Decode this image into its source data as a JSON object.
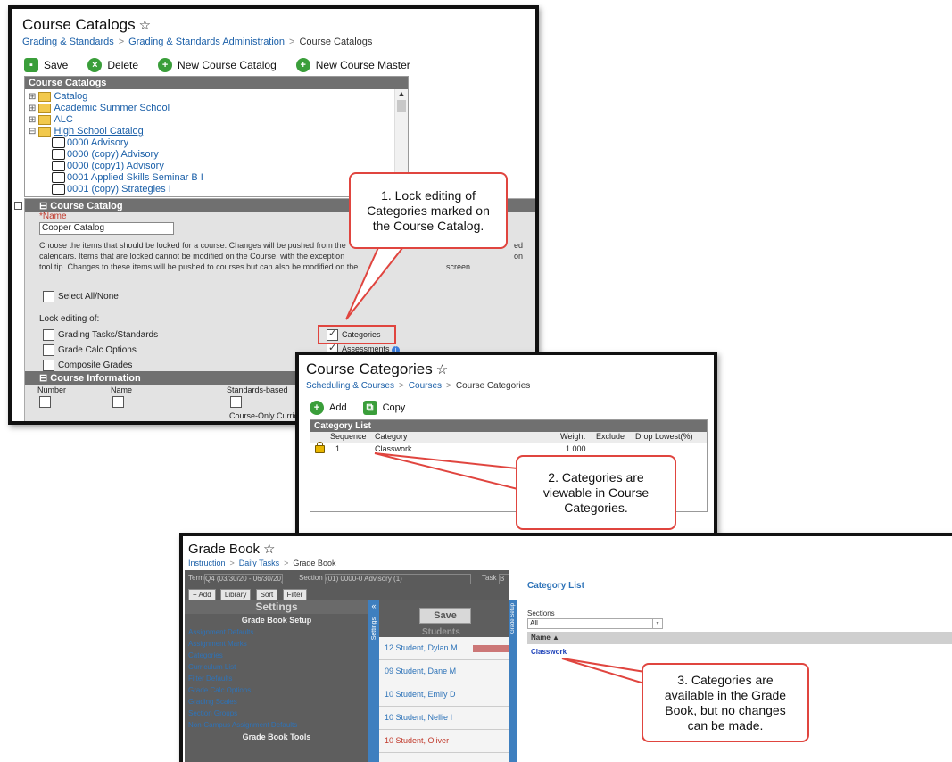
{
  "colors": {
    "accent": "#3a9e3a",
    "link": "#1a5fa8",
    "callout_border": "#e0453f",
    "header": "#707070"
  },
  "panel1": {
    "title": "Course Catalogs",
    "breadcrumb": [
      "Grading & Standards",
      "Grading & Standards Administration",
      "Course Catalogs"
    ],
    "toolbar": {
      "save": "Save",
      "delete": "Delete",
      "new_catalog": "New Course Catalog",
      "new_master": "New Course Master"
    },
    "tree_header": "Course Catalogs",
    "tree": [
      "Catalog",
      "Academic Summer School",
      "ALC",
      "High School Catalog",
      "0000 Advisory",
      "0000 (copy) Advisory",
      "0000 (copy1) Advisory",
      "0001 Applied Skills Seminar B I",
      "0001 (copy) Strategies I"
    ],
    "section_header": "Course Catalog",
    "name_label": "*Name",
    "name_value": "Cooper Catalog",
    "description_1": "Choose the items that should be locked for a course. Changes will be pushed from the",
    "description_1_end": "ed",
    "description_2": "calendars. Items that are locked cannot be modified on the Course, with the exception",
    "description_2_end": "on",
    "description_3": "tool tip. Changes to these items will be pushed to courses but can also be modified on the",
    "description_3_end": "screen.",
    "select_all": "Select All/None",
    "lock_label": "Lock editing of:",
    "options_left": [
      "Grading Tasks/Standards",
      "Grade Calc Options",
      "Composite Grades"
    ],
    "option_categories": "Categories",
    "option_assessments": "Assessments",
    "info_header": "Course Information",
    "info_cols": {
      "number": "Number",
      "name": "Name",
      "standards": "Standards-based",
      "curriculum": "Course-Only Curricu"
    }
  },
  "panel2": {
    "title": "Course Categories",
    "breadcrumb": [
      "Scheduling & Courses",
      "Courses",
      "Course Categories"
    ],
    "toolbar": {
      "add": "Add",
      "copy": "Copy"
    },
    "list_header": "Category List",
    "columns": [
      "Sequence",
      "Category",
      "Weight",
      "Exclude",
      "Drop Lowest(%)"
    ],
    "rows": [
      {
        "sequence": "1",
        "category": "Classwork",
        "weight": "1.000"
      }
    ]
  },
  "panel3": {
    "title": "Grade Book",
    "breadcrumb": [
      "Instruction",
      "Daily Tasks",
      "Grade Book"
    ],
    "term_label": "Term",
    "term_value": "Q4 (03/30/20 - 06/30/20)",
    "section_label": "Section",
    "section_value": "(01) 0000-0 Advisory (1)",
    "task_label": "Task",
    "task_value": "B",
    "buttons": [
      "+ Add",
      "Library",
      "Sort",
      "Filter"
    ],
    "settings_title": "Settings",
    "setup_title": "Grade Book Setup",
    "setup_links": [
      "Assignment Defaults",
      "Assignment Marks",
      "Categories",
      "Curriculum List",
      "Filter Defaults",
      "Grade Calc Options",
      "Grading Scales",
      "Section Groups",
      "Non-Campus Assignment Defaults"
    ],
    "tools_title": "Grade Book Tools",
    "side_tab": "Settings",
    "side_tab_right": "Grade Setup",
    "save": "Save",
    "students_header": "Students",
    "students": [
      {
        "grade": "12",
        "name": "Student, Dylan M"
      },
      {
        "grade": "09",
        "name": "Student, Dane M"
      },
      {
        "grade": "10",
        "name": "Student, Emily D"
      },
      {
        "grade": "10",
        "name": "Student, Nellie I"
      },
      {
        "grade": "10",
        "name": "Student, Oliver"
      }
    ],
    "category_list_title": "Category List",
    "sections_label": "Sections",
    "sections_value": "All",
    "name_col": "Name",
    "category_item": "Classwork"
  },
  "callouts": {
    "one": "1. Lock editing of Categories marked on the Course Catalog.",
    "two": "2. Categories are viewable in Course Categories.",
    "three": "3. Categories are available in the Grade Book, but no changes can be made."
  }
}
